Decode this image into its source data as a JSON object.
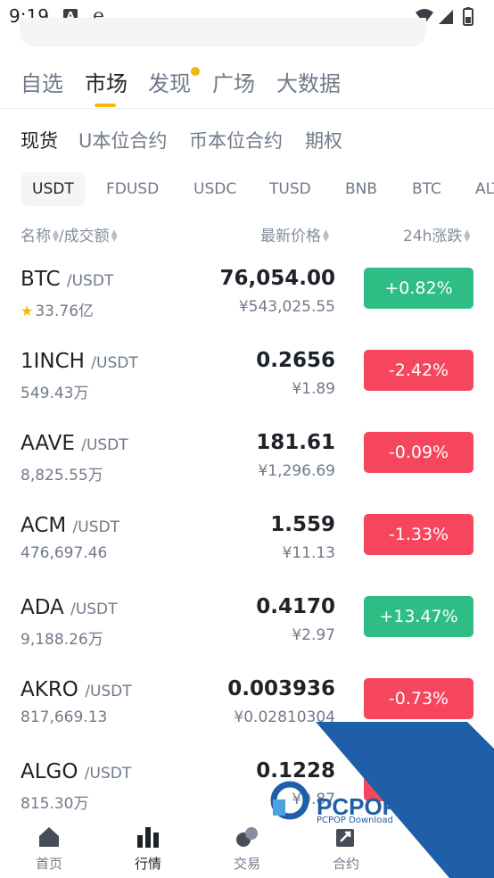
{
  "status_bar": {
    "time": "9:19",
    "icon_a": "A",
    "icon_e": "e"
  },
  "main_tabs": [
    {
      "label": "自选"
    },
    {
      "label": "市场"
    },
    {
      "label": "发现"
    },
    {
      "label": "广场"
    },
    {
      "label": "大数据"
    }
  ],
  "sub_tabs": [
    {
      "label": "现货"
    },
    {
      "label": "U本位合约"
    },
    {
      "label": "币本位合约"
    },
    {
      "label": "期权"
    }
  ],
  "quote_tabs": [
    {
      "label": "USDT"
    },
    {
      "label": "FDUSD"
    },
    {
      "label": "USDC"
    },
    {
      "label": "TUSD"
    },
    {
      "label": "BNB"
    },
    {
      "label": "BTC"
    },
    {
      "label": "ALT"
    }
  ],
  "headers": {
    "name": "名称",
    "separator": "/",
    "volume": "成交额",
    "price": "最新价格",
    "change": "24h涨跌"
  },
  "rows": [
    {
      "base": "BTC",
      "quote": "/USDT",
      "volume": "33.76亿",
      "price": "76,054.00",
      "fiat": "¥543,025.55",
      "change": "+0.82%",
      "favorite": "★"
    },
    {
      "base": "1INCH",
      "quote": "/USDT",
      "volume": "549.43万",
      "price": "0.2656",
      "fiat": "¥1.89",
      "change": "-2.42%"
    },
    {
      "base": "AAVE",
      "quote": "/USDT",
      "volume": "8,825.55万",
      "price": "181.61",
      "fiat": "¥1,296.69",
      "change": "-0.09%"
    },
    {
      "base": "ACM",
      "quote": "/USDT",
      "volume": "476,697.46",
      "price": "1.559",
      "fiat": "¥11.13",
      "change": "-1.33%"
    },
    {
      "base": "ADA",
      "quote": "/USDT",
      "volume": "9,188.26万",
      "price": "0.4170",
      "fiat": "¥2.97",
      "change": "+13.47%"
    },
    {
      "base": "AKRO",
      "quote": "/USDT",
      "volume": "817,669.13",
      "price": "0.003936",
      "fiat": "¥0.02810304",
      "change": "-0.73%"
    },
    {
      "base": "ALGO",
      "quote": "/USDT",
      "volume": "815.30万",
      "price": "0.1228",
      "fiat": "¥0.87",
      "change": ""
    }
  ],
  "bottom_nav": [
    {
      "label": "首页",
      "icon": "home-icon"
    },
    {
      "label": "行情",
      "icon": "markets-icon"
    },
    {
      "label": "交易",
      "icon": "trade-icon"
    },
    {
      "label": "合约",
      "icon": "futures-icon"
    }
  ],
  "watermark": {
    "brand": "PCPOP下载",
    "sub": "PCPOP Download"
  },
  "colors": {
    "accent": "#f0b90b",
    "up": "#2ebd85",
    "down": "#f6465d",
    "text": "#1e2329",
    "muted": "#707a8a",
    "watermark": "#1f5fa8"
  }
}
